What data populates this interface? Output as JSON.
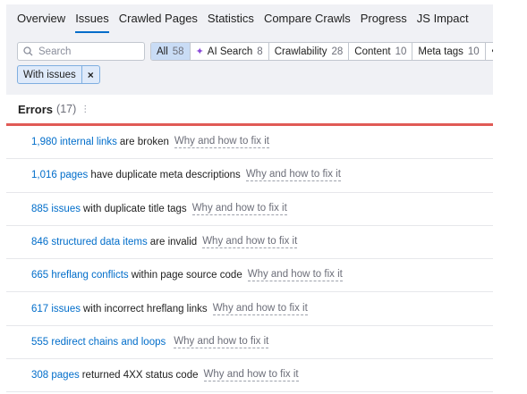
{
  "tabs": [
    "Overview",
    "Issues",
    "Crawled Pages",
    "Statistics",
    "Compare Crawls",
    "Progress",
    "JS Impact"
  ],
  "active_tab": "Issues",
  "search": {
    "placeholder": "Search",
    "icon": "search-icon"
  },
  "segments": [
    {
      "label": "All",
      "count": "58",
      "selected": true
    },
    {
      "label": "AI Search",
      "count": "8",
      "icon": "sparkle-icon"
    },
    {
      "label": "Crawlability",
      "count": "28"
    },
    {
      "label": "Content",
      "count": "10"
    },
    {
      "label": "Meta tags",
      "count": "10"
    }
  ],
  "more_label": "•••",
  "active_filter": {
    "label": "With issues",
    "close": "×"
  },
  "errors": {
    "title": "Errors",
    "count": "(17)",
    "info_icon": "⋮",
    "accent_color": "#e05a55",
    "fix_label": "Why and how to fix it",
    "items": [
      {
        "link": "1,980 internal links",
        "text": "are broken"
      },
      {
        "link": "1,016 pages",
        "text": "have duplicate meta descriptions"
      },
      {
        "link": "885 issues",
        "text": "with duplicate title tags"
      },
      {
        "link": "846 structured data items",
        "text": "are invalid"
      },
      {
        "link": "665 hreflang conflicts",
        "text": "within page source code"
      },
      {
        "link": "617 issues",
        "text": "with incorrect hreflang links"
      },
      {
        "link": "555 redirect chains and loops",
        "text": ""
      },
      {
        "link": "308 pages",
        "text": "returned 4XX status code"
      }
    ]
  },
  "colors": {
    "link": "#006dca",
    "tab_underline": "#006dca",
    "selected_segment": "#c9dcf5"
  }
}
